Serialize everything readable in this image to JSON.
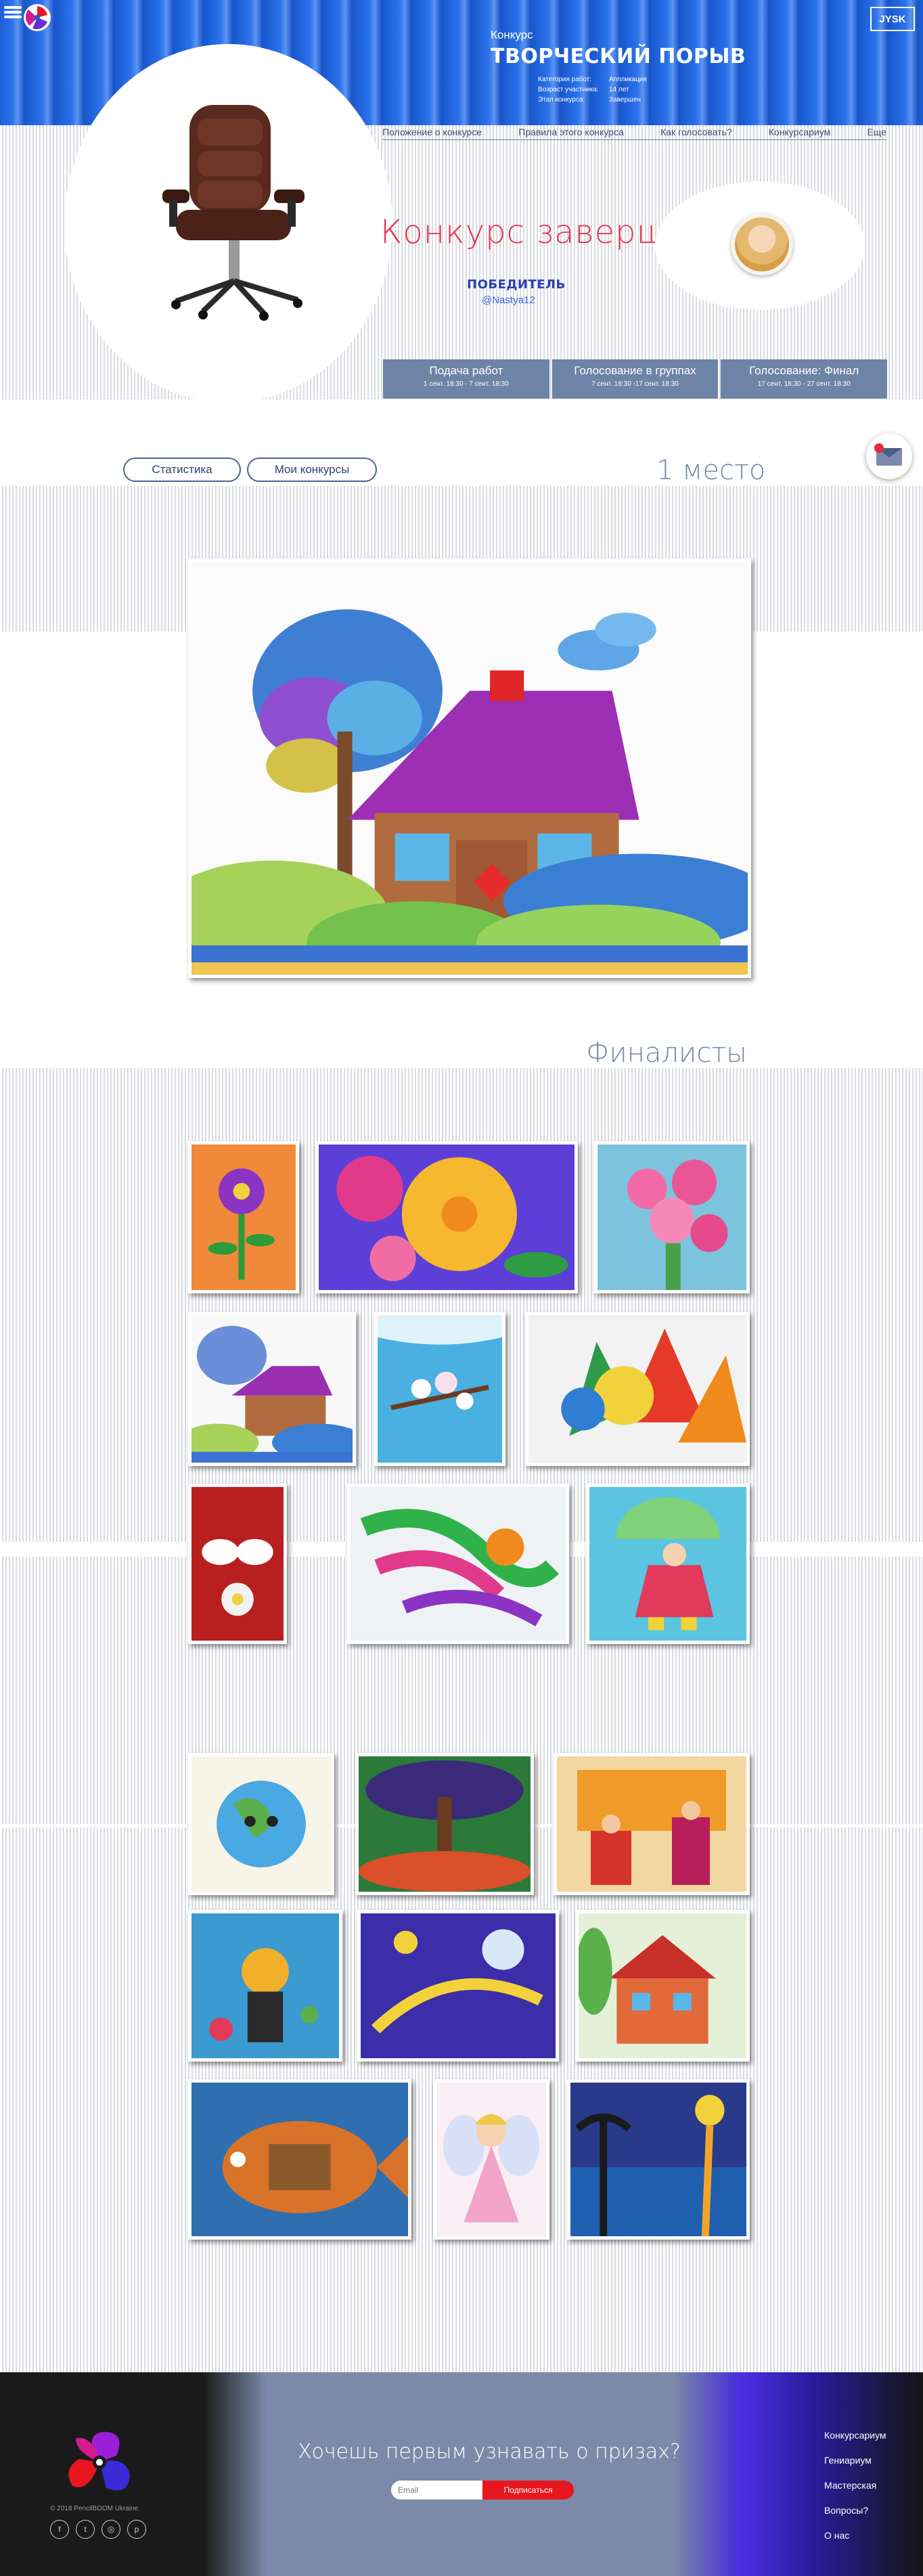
{
  "header": {
    "contest_kicker": "Конкурс",
    "contest_title": "ТВОРЧЕСКИЙ ПОРЫВ",
    "meta": [
      {
        "key": "Категория работ:",
        "value": "Аппликация"
      },
      {
        "key": "Возраст участника:",
        "value": "14 лет"
      },
      {
        "key": "Этап конкурса:",
        "value": "Завершен"
      }
    ],
    "sponsor": "JYSK"
  },
  "nav": [
    "Положение о конкурсе",
    "Правила этого конкурса",
    "Как голосовать?",
    "Конкурсариум",
    "Еще"
  ],
  "status": {
    "title": "Конкурс завершен",
    "winner_label": "ПОБЕДИТЕЛЬ",
    "winner_name": "@Nastya12"
  },
  "stages": [
    {
      "title": "Подача работ",
      "dates": "1 сент. 18:30 - 7 сент. 18:30"
    },
    {
      "title": "Голосование в группах",
      "dates": "7 сент. 18:30 -17 сент. 18:30"
    },
    {
      "title": "Голосование: Финал",
      "dates": "17 сент. 18:30 - 27 сент. 18:30"
    }
  ],
  "buttons": {
    "stats": "Статистика",
    "my_contests": "Мои конкурсы"
  },
  "first_place": "1 место",
  "finalists_title": "Финалисты",
  "footer": {
    "cta": "Хочешь первым узнавать о призах?",
    "email_placeholder": "Email",
    "subscribe": "Подписаться",
    "links": [
      "Конкурсариум",
      "Гениариум",
      "Мастерская",
      "Вопросы?",
      "О нас"
    ],
    "copyright": "© 2018 PencilBOOM Ukraine",
    "socials": [
      "f",
      "t",
      "◎",
      "p"
    ]
  },
  "colors": {
    "accent": "#e8344e",
    "brand_blue": "#1d5fd6",
    "stage_bg": "#6e84a6",
    "subscribe": "#e8161f"
  }
}
